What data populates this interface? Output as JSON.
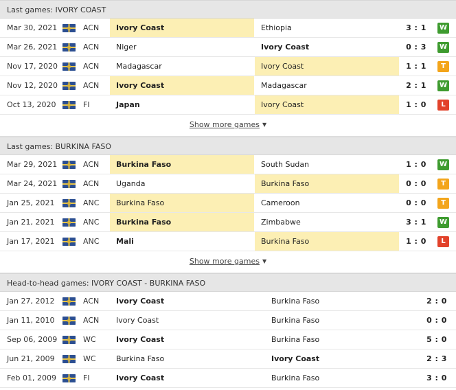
{
  "colors": {
    "win": "#3e9b2f",
    "draw": "#f3a51b",
    "loss": "#e2422b",
    "highlight": "#fcefb4"
  },
  "sections": [
    {
      "title": "Last games: IVORY COAST",
      "rows": [
        {
          "date": "Mar 30, 2021",
          "comp": "ACN",
          "home": "Ivory Coast",
          "away": "Ethiopia",
          "score": "3 : 1",
          "result": "W",
          "hl": "home",
          "bold": "home"
        },
        {
          "date": "Mar 26, 2021",
          "comp": "ACN",
          "home": "Niger",
          "away": "Ivory Coast",
          "score": "0 : 3",
          "result": "W",
          "hl": "",
          "bold": "away"
        },
        {
          "date": "Nov 17, 2020",
          "comp": "ACN",
          "home": "Madagascar",
          "away": "Ivory Coast",
          "score": "1 : 1",
          "result": "T",
          "hl": "away",
          "bold": ""
        },
        {
          "date": "Nov 12, 2020",
          "comp": "ACN",
          "home": "Ivory Coast",
          "away": "Madagascar",
          "score": "2 : 1",
          "result": "W",
          "hl": "home",
          "bold": "home"
        },
        {
          "date": "Oct 13, 2020",
          "comp": "FI",
          "home": "Japan",
          "away": "Ivory Coast",
          "score": "1 : 0",
          "result": "L",
          "hl": "away",
          "bold": "home"
        }
      ],
      "show_more": "Show more games"
    },
    {
      "title": "Last games: BURKINA FASO",
      "rows": [
        {
          "date": "Mar 29, 2021",
          "comp": "ACN",
          "home": "Burkina Faso",
          "away": "South Sudan",
          "score": "1 : 0",
          "result": "W",
          "hl": "home",
          "bold": "home"
        },
        {
          "date": "Mar 24, 2021",
          "comp": "ACN",
          "home": "Uganda",
          "away": "Burkina Faso",
          "score": "0 : 0",
          "result": "T",
          "hl": "away",
          "bold": ""
        },
        {
          "date": "Jan 25, 2021",
          "comp": "ANC",
          "home": "Burkina Faso",
          "away": "Cameroon",
          "score": "0 : 0",
          "result": "T",
          "hl": "home",
          "bold": ""
        },
        {
          "date": "Jan 21, 2021",
          "comp": "ANC",
          "home": "Burkina Faso",
          "away": "Zimbabwe",
          "score": "3 : 1",
          "result": "W",
          "hl": "home",
          "bold": "home"
        },
        {
          "date": "Jan 17, 2021",
          "comp": "ANC",
          "home": "Mali",
          "away": "Burkina Faso",
          "score": "1 : 0",
          "result": "L",
          "hl": "away",
          "bold": "home"
        }
      ],
      "show_more": "Show more games"
    }
  ],
  "h2h": {
    "title": "Head-to-head games: IVORY COAST - BURKINA FASO",
    "rows": [
      {
        "date": "Jan 27, 2012",
        "comp": "ACN",
        "home": "Ivory Coast",
        "away": "Burkina Faso",
        "score": "2 : 0",
        "bold": "home"
      },
      {
        "date": "Jan 11, 2010",
        "comp": "ACN",
        "home": "Ivory Coast",
        "away": "Burkina Faso",
        "score": "0 : 0",
        "bold": ""
      },
      {
        "date": "Sep 06, 2009",
        "comp": "WC",
        "home": "Ivory Coast",
        "away": "Burkina Faso",
        "score": "5 : 0",
        "bold": "home"
      },
      {
        "date": "Jun 21, 2009",
        "comp": "WC",
        "home": "Burkina Faso",
        "away": "Ivory Coast",
        "score": "2 : 3",
        "bold": "away"
      },
      {
        "date": "Feb 01, 2009",
        "comp": "FI",
        "home": "Ivory Coast",
        "away": "Burkina Faso",
        "score": "3 : 0",
        "bold": "home"
      }
    ]
  }
}
